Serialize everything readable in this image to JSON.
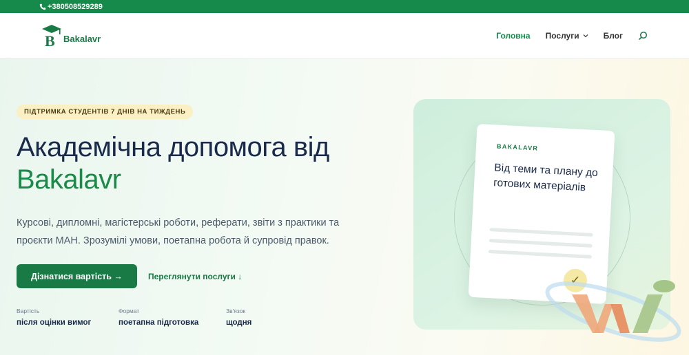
{
  "topbar": {
    "phone": "+380508529289",
    "phone_icon": "phone-icon"
  },
  "header": {
    "logo_text": "Bakalavr",
    "nav": [
      {
        "label": "Головна",
        "active": true
      },
      {
        "label": "Послуги",
        "dropdown": true
      },
      {
        "label": "Блог"
      }
    ],
    "search_icon": "search-icon"
  },
  "hero": {
    "badge": "ПІДТРИМКА СТУДЕНТІВ 7 ДНІВ НА ТИЖДЕНЬ",
    "title_line1": "Академічна допомога від",
    "title_accent": "Bakalavr",
    "description": "Курсові, дипломні, магістерські роботи, реферати, звіти з практики та проєкти МАН. Зрозумілі умови, поетапна робота й супровід правок.",
    "primary_button": "Дізнатися вартість →",
    "secondary_link": "Переглянути послуги ↓",
    "facts": [
      {
        "label": "Вартість",
        "value": "після оцінки вимог"
      },
      {
        "label": "Формат",
        "value": "поетапна підготовка"
      },
      {
        "label": "Зв'язок",
        "value": "щодня"
      }
    ]
  },
  "card": {
    "brand": "BAKALAVR",
    "text": "Від теми та плану до готових матеріалів",
    "check": "✓"
  },
  "colors": {
    "brand_green": "#168a4b",
    "badge_bg": "#fbefc4"
  }
}
